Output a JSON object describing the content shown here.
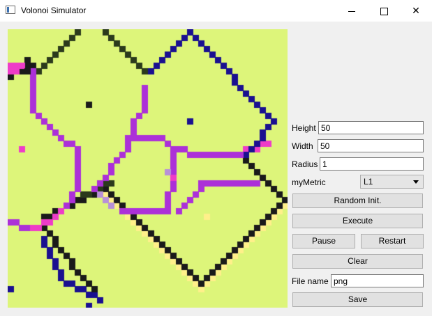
{
  "window": {
    "title": "Volonoi Simulator",
    "minimize": "—",
    "maximize": "☐",
    "close": "✕"
  },
  "form": {
    "height_label": "Height",
    "height_value": "50",
    "width_label": "Width",
    "width_value": "50",
    "radius_label": "Radius",
    "radius_value": "1",
    "metric_label": "myMetric",
    "metric_value": "L1",
    "filename_label": "File name",
    "filename_value": "png"
  },
  "buttons": {
    "random_init": "Random Init.",
    "execute": "Execute",
    "pause": "Pause",
    "restart": "Restart",
    "clear": "Clear",
    "save": "Save"
  },
  "grid": {
    "size": 50,
    "background": "#ddf57a",
    "colors": {
      "black": "#1a1a1a",
      "navy": "#1a1090",
      "purple": "#ac30d8",
      "pink": "#ee3cc8",
      "lavender": "#b890d8",
      "yellow": "#fff08a",
      "darkgreen": "#2b3a1c"
    }
  }
}
